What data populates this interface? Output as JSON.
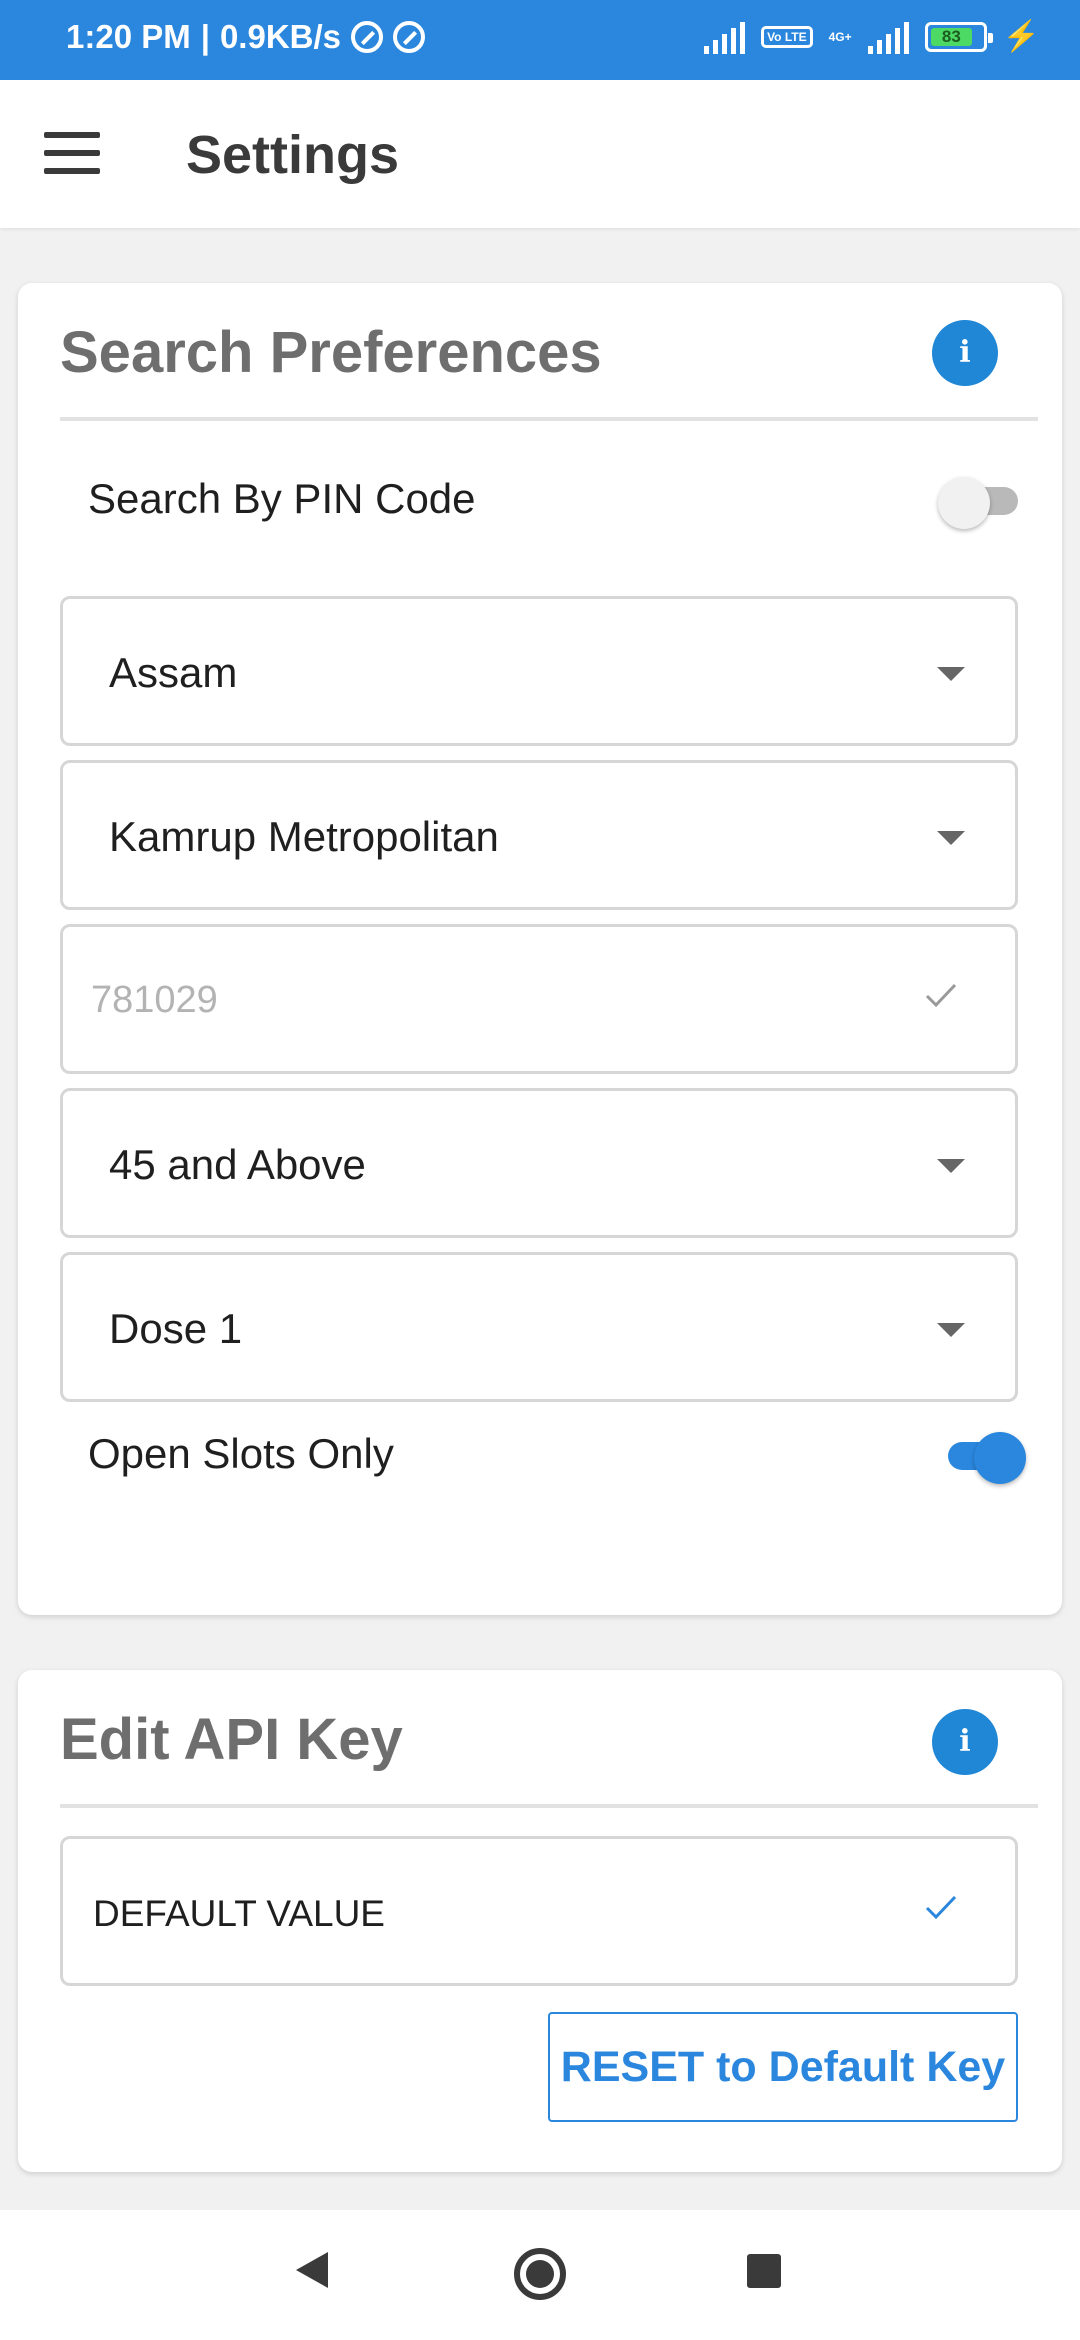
{
  "status_bar": {
    "time": "1:20 PM",
    "net_speed": "0.9KB/s",
    "volte": "Vo LTE",
    "network_type": "4G+",
    "battery": "83"
  },
  "app_bar": {
    "menu_icon": "menu-icon",
    "title": "Settings"
  },
  "search_preferences": {
    "title": "Search Preferences",
    "info_icon": "i",
    "search_by_pin": {
      "label": "Search By PIN Code",
      "checked": false
    },
    "state": "Assam",
    "district": "Kamrup Metropolitan",
    "pincode_placeholder": "781029",
    "age_group": "45 and Above",
    "dose": "Dose 1",
    "open_slots": {
      "label": "Open Slots Only",
      "checked": true
    }
  },
  "api_key": {
    "title": "Edit API Key",
    "info_icon": "i",
    "value": "DEFAULT VALUE",
    "reset_label": "RESET to Default Key"
  },
  "colors": {
    "accent": "#2b87de",
    "section_title": "#6e6e6e",
    "background": "#f1f1f1"
  }
}
